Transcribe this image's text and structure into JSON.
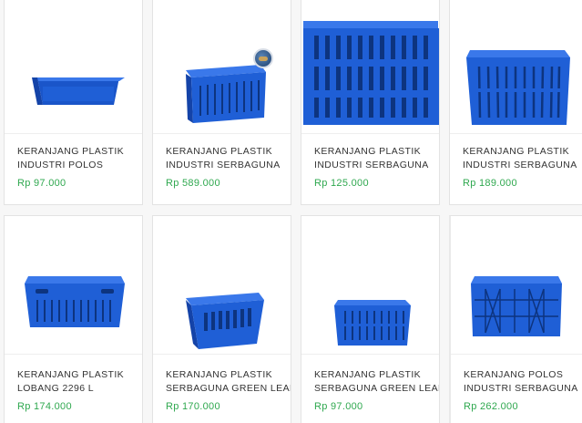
{
  "products": [
    {
      "name_line1": "KERANJANG PLASTIK",
      "name_line2": "INDUSTRI POLOS",
      "price": "Rp 97.000",
      "image_icon": "blue-solid-crate-image"
    },
    {
      "name_line1": "KERANJANG PLASTIK",
      "name_line2": "INDUSTRI SERBAGUNA",
      "price": "Rp 589.000",
      "image_icon": "blue-slotted-crate-image"
    },
    {
      "name_line1": "KERANJANG PLASTIK",
      "name_line2": "INDUSTRI SERBAGUNA",
      "price": "Rp 125.000",
      "image_icon": "large-blue-slotted-crate-image"
    },
    {
      "name_line1": "KERANJANG PLASTIK",
      "name_line2": "INDUSTRI SERBAGUNA",
      "price": "Rp 189.000",
      "image_icon": "blue-slotted-crate-image"
    },
    {
      "name_line1": "KERANJANG PLASTIK",
      "name_line2": "LOBANG 2296 L",
      "price": "Rp 174.000",
      "image_icon": "blue-perforated-crate-image"
    },
    {
      "name_line1": "KERANJANG PLASTIK",
      "name_line2": "SERBAGUNA GREEN LEAF",
      "price": "Rp 170.000",
      "image_icon": "blue-tapered-crate-image"
    },
    {
      "name_line1": "KERANJANG PLASTIK",
      "name_line2": "SERBAGUNA GREEN LEAF",
      "price": "Rp 97.000",
      "image_icon": "blue-slotted-crate-image"
    },
    {
      "name_line1": "KERANJANG POLOS",
      "name_line2": "INDUSTRI SERBAGUNA",
      "price": "Rp 262.000",
      "image_icon": "blue-grid-crate-image"
    }
  ],
  "colors": {
    "price": "#2fa84f",
    "crate_blue": "#1f5fd6",
    "crate_dark": "#1443a8"
  }
}
